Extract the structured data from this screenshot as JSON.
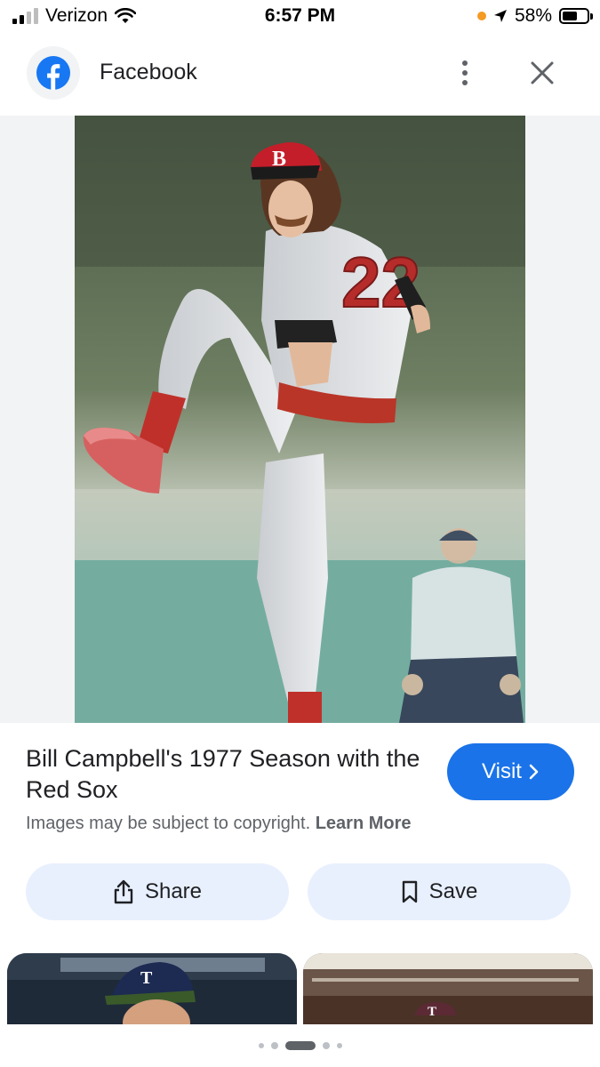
{
  "status_bar": {
    "carrier": "Verizon",
    "time": "6:57 PM",
    "battery": "58%",
    "battery_level": 0.58
  },
  "header": {
    "site_name": "Facebook",
    "site_icon": "facebook-logo-icon",
    "menu_icon": "more-vert-icon",
    "close_icon": "close-icon"
  },
  "result": {
    "title": "Bill Campbell's 1977 Season with the Red Sox",
    "visit_label": "Visit",
    "copyright_text": "Images may be subject to copyright.",
    "learn_more_label": "Learn More"
  },
  "actions": {
    "share_label": "Share",
    "save_label": "Save"
  },
  "carousel": {
    "page_indicator_count": 5,
    "active_index": 2
  },
  "colors": {
    "accent": "#1a73e8",
    "action_bg": "#e8f0fe",
    "image_bg": "#f1f3f4"
  }
}
